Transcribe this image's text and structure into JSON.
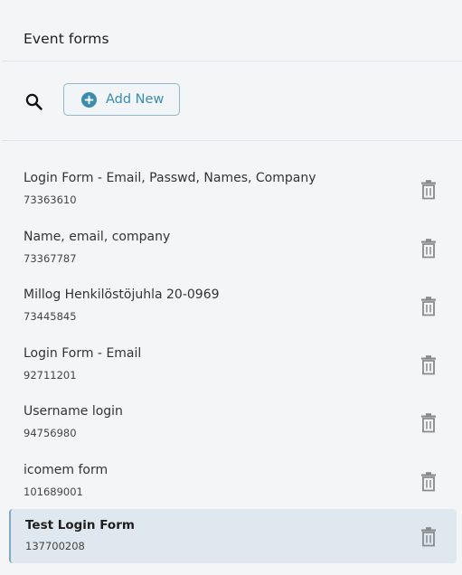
{
  "panel": {
    "title": "Event forms"
  },
  "toolbar": {
    "search_icon": "search-icon",
    "add_label": "Add New",
    "add_icon": "plus-circle-icon",
    "accent_color": "#3b8bb0"
  },
  "forms": [
    {
      "name": "Login Form - Email, Passwd, Names, Company",
      "code": "73363610"
    },
    {
      "name": "Name, email, company",
      "code": "73367787"
    },
    {
      "name": "Millog Henkilöstöjuhla 20-0969",
      "code": "73445845"
    },
    {
      "name": "Login Form - Email",
      "code": "92711201"
    },
    {
      "name": "Username login",
      "code": "94756980"
    },
    {
      "name": "icomem form",
      "code": "101689001"
    },
    {
      "name": "Test Login Form",
      "code": "137700208",
      "selected": true
    }
  ],
  "row_icon": "trash-icon"
}
